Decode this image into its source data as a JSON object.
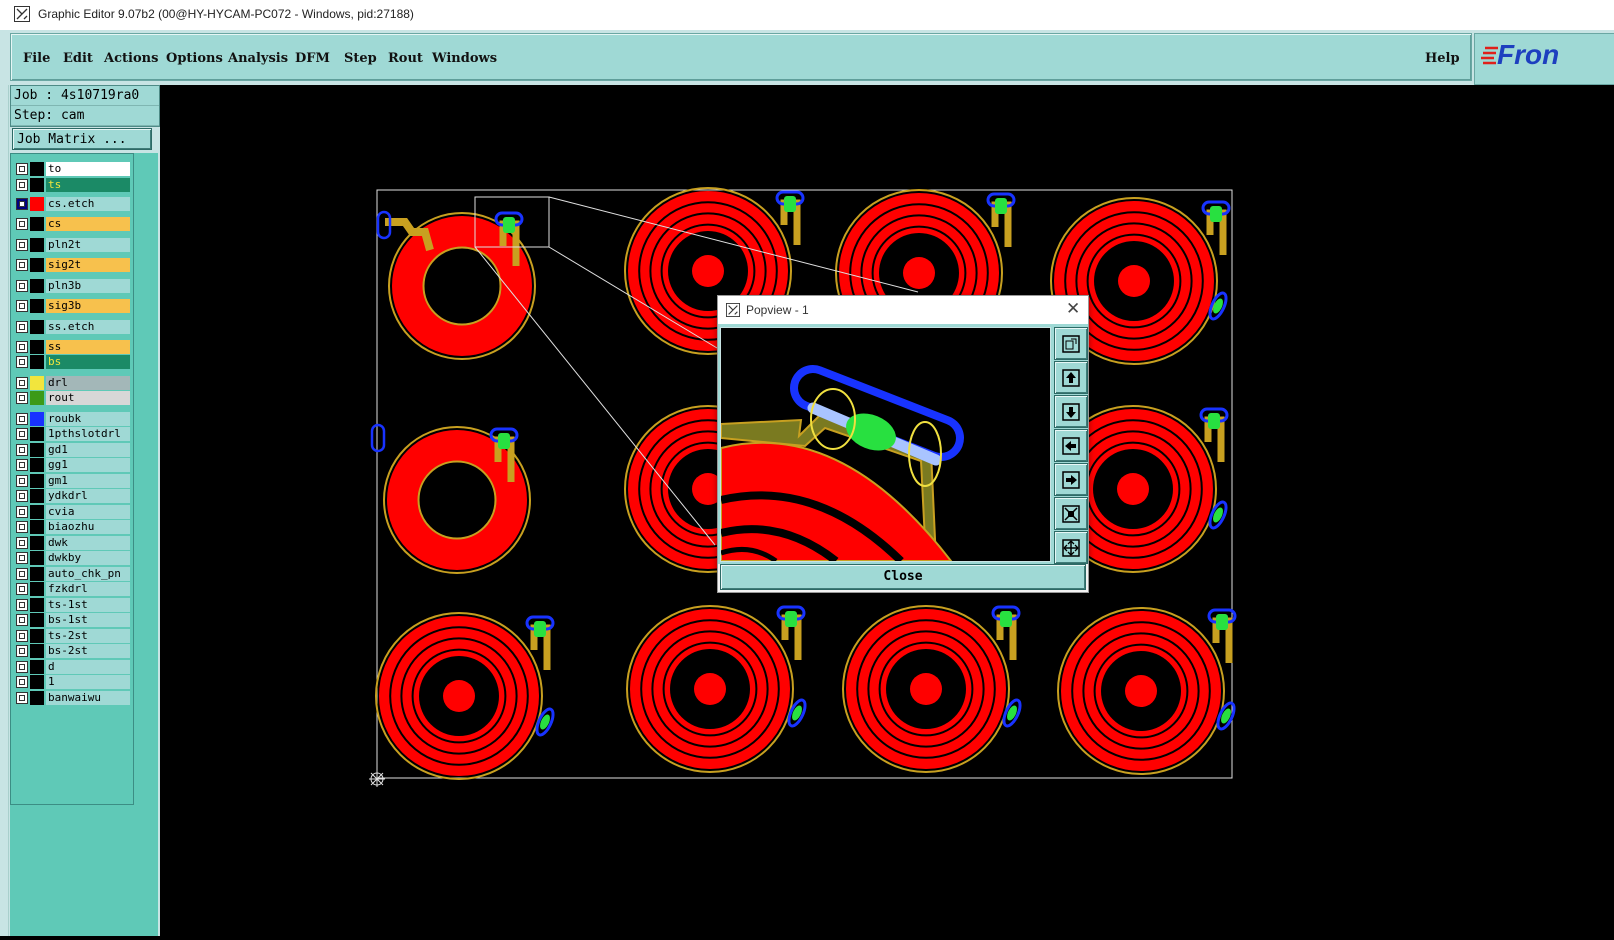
{
  "window": {
    "title": "Graphic Editor 9.07b2 (00@HY-HYCAM-PC072 - Windows, pid:27188)"
  },
  "menu": {
    "items": [
      {
        "label": "File"
      },
      {
        "label": "Edit"
      },
      {
        "label": "Actions"
      },
      {
        "label": "Options"
      },
      {
        "label": "Analysis"
      },
      {
        "label": "DFM"
      },
      {
        "label": "Step"
      },
      {
        "label": "Rout"
      },
      {
        "label": "Windows"
      }
    ],
    "help": "Help",
    "logo_text": "Fron"
  },
  "job": {
    "job_line": "Job : 4s10719ra0",
    "step_line": "Step: cam",
    "matrix_button": "Job Matrix ..."
  },
  "layers": [
    {
      "name": "to",
      "color": "#000000",
      "bg": "#ffffff",
      "checked": false
    },
    {
      "name": "ts",
      "color": "#000000",
      "bg": "#1b8a66",
      "checked": false
    },
    {
      "name": "cs.etch",
      "color": "#ff0000",
      "bg": "#9fd9d5",
      "checked": true
    },
    {
      "name": "cs",
      "color": "#000000",
      "bg": "#f7c14d",
      "checked": false
    },
    {
      "name": "pln2t",
      "color": "#000000",
      "bg": "#9fd9d5",
      "checked": false
    },
    {
      "name": "sig2t",
      "color": "#000000",
      "bg": "#f7c14d",
      "checked": false
    },
    {
      "name": "pln3b",
      "color": "#000000",
      "bg": "#9fd9d5",
      "checked": false
    },
    {
      "name": "sig3b",
      "color": "#000000",
      "bg": "#f7c14d",
      "checked": false
    },
    {
      "name": "ss.etch",
      "color": "#000000",
      "bg": "#9fd9d5",
      "checked": false
    },
    {
      "name": "ss",
      "color": "#000000",
      "bg": "#f7c14d",
      "checked": false
    },
    {
      "name": "bs",
      "color": "#000000",
      "bg": "#1b8a66",
      "checked": false
    },
    {
      "name": "drl",
      "color": "#f2e53d",
      "bg": "#a3b7b8",
      "checked": false
    },
    {
      "name": "rout",
      "color": "#3c9a18",
      "bg": "#d7d7d7",
      "checked": false
    },
    {
      "name": "roubk",
      "color": "#1833ff",
      "bg": "#9fd9d5",
      "checked": false
    },
    {
      "name": "1pthslotdrl",
      "color": "#000000",
      "bg": "#9fd9d5",
      "checked": false
    },
    {
      "name": "gd1",
      "color": "#000000",
      "bg": "#9fd9d5",
      "checked": false
    },
    {
      "name": "gg1",
      "color": "#000000",
      "bg": "#9fd9d5",
      "checked": false
    },
    {
      "name": "gm1",
      "color": "#000000",
      "bg": "#9fd9d5",
      "checked": false
    },
    {
      "name": "ydkdrl",
      "color": "#000000",
      "bg": "#9fd9d5",
      "checked": false
    },
    {
      "name": "cvia",
      "color": "#000000",
      "bg": "#9fd9d5",
      "checked": false
    },
    {
      "name": "biaozhu",
      "color": "#000000",
      "bg": "#9fd9d5",
      "checked": false
    },
    {
      "name": "dwk",
      "color": "#000000",
      "bg": "#9fd9d5",
      "checked": false
    },
    {
      "name": "dwkby",
      "color": "#000000",
      "bg": "#9fd9d5",
      "checked": false
    },
    {
      "name": "auto_chk_pn",
      "color": "#000000",
      "bg": "#9fd9d5",
      "checked": false
    },
    {
      "name": "fzkdrl",
      "color": "#000000",
      "bg": "#9fd9d5",
      "checked": false
    },
    {
      "name": "ts-1st",
      "color": "#000000",
      "bg": "#9fd9d5",
      "checked": false
    },
    {
      "name": "bs-1st",
      "color": "#000000",
      "bg": "#9fd9d5",
      "checked": false
    },
    {
      "name": "ts-2st",
      "color": "#000000",
      "bg": "#9fd9d5",
      "checked": false
    },
    {
      "name": "bs-2st",
      "color": "#000000",
      "bg": "#9fd9d5",
      "checked": false
    },
    {
      "name": "d",
      "color": "#000000",
      "bg": "#9fd9d5",
      "checked": false
    },
    {
      "name": "1",
      "color": "#000000",
      "bg": "#9fd9d5",
      "checked": false
    },
    {
      "name": "banwaiwu",
      "color": "#000000",
      "bg": "#9fd9d5",
      "checked": false
    }
  ],
  "popview": {
    "title": "Popview - 1",
    "close_label": "Close"
  },
  "colors": {
    "panel": "#9fd9d5",
    "copper": "#ff0000",
    "outline": "#c8a020",
    "route": "#1833ff",
    "pad": "#28e040"
  }
}
